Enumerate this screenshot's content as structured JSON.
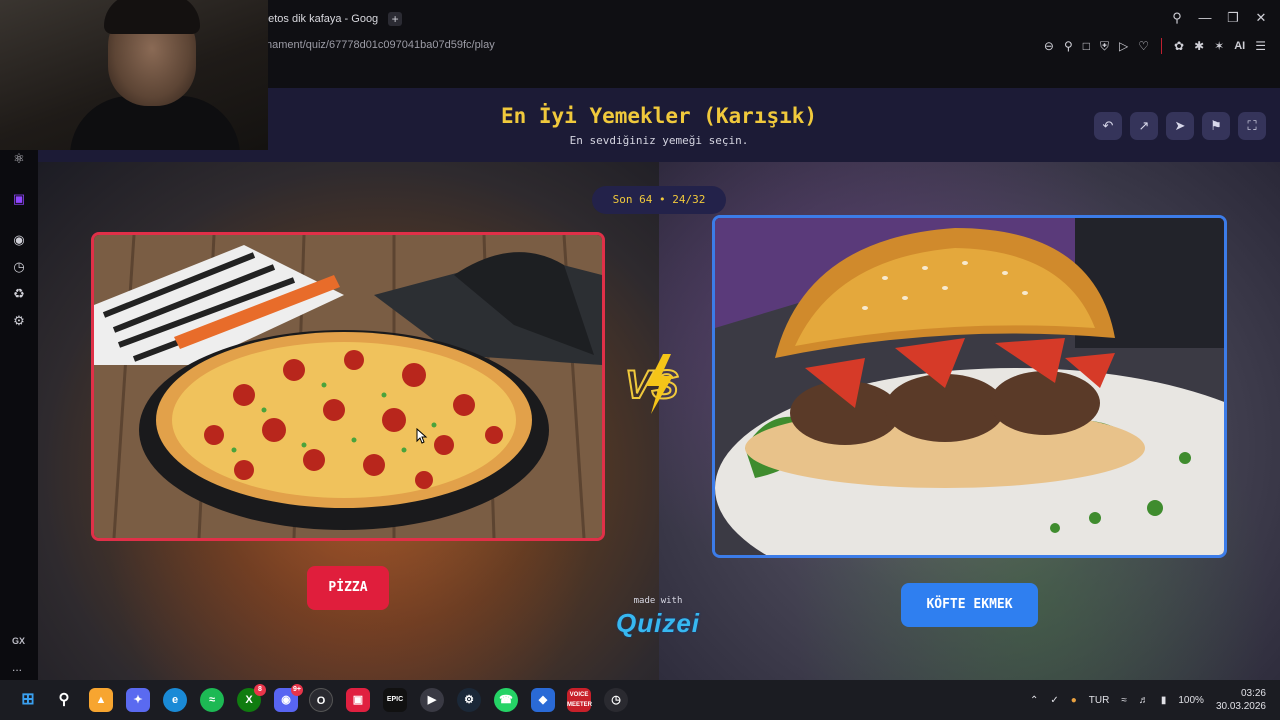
{
  "browser": {
    "tab_title": "eetos dik kafaya - Goog",
    "new_tab": "+",
    "url": "nament/quiz/67778d01c097041ba07d59fc/play",
    "ai_label": "AI"
  },
  "sidebar": {
    "gx_label": "GX",
    "more_label": "..."
  },
  "quiz": {
    "title": "En İyi Yemekler (Karışık)",
    "subtitle": "En sevdiğiniz yemeği seçin.",
    "counter": "Son 64 • 24/32",
    "left_choice": "PİZZA",
    "right_choice": "KÖFTE EKMEK",
    "made_with": "made with",
    "brand": "Quizei"
  },
  "taskbar": {
    "discord_badge": "9+",
    "xbox_badge": "8",
    "language": "TUR",
    "battery": "100%",
    "time": "03:26",
    "date": "30.03.2026"
  },
  "colors": {
    "title_gold": "#f0c93c",
    "left_accent": "#e01e3c",
    "right_accent": "#2f7ff0",
    "header_bg": "#1c1b36"
  }
}
